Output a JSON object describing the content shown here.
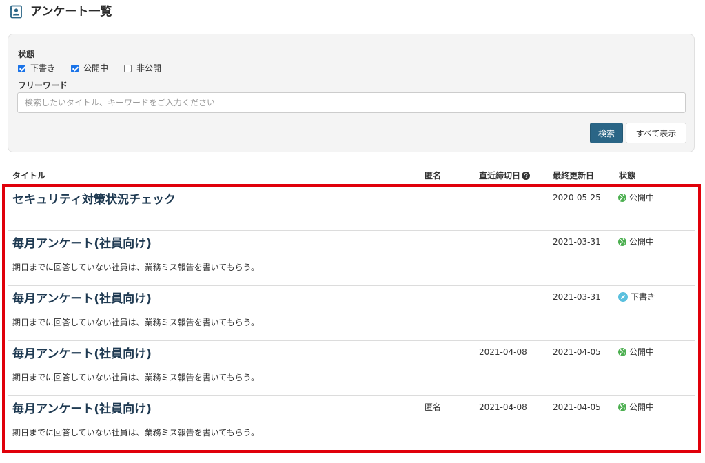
{
  "header": {
    "title": "アンケート一覧"
  },
  "filter": {
    "status_label": "状態",
    "checkboxes": [
      {
        "label": "下書き",
        "checked": true
      },
      {
        "label": "公開中",
        "checked": true
      },
      {
        "label": "非公開",
        "checked": false
      }
    ],
    "keyword_label": "フリーワード",
    "keyword_value": "",
    "keyword_placeholder": "検索したいタイトル、キーワードをご入力ください",
    "search_button": "検索",
    "show_all_button": "すべて表示"
  },
  "table": {
    "headers": {
      "title": "タイトル",
      "anonymous": "匿名",
      "deadline": "直近締切日",
      "updated": "最終更新日",
      "status": "状態"
    },
    "rows": [
      {
        "title": "セキュリティ対策状況チェック",
        "description": "",
        "anonymous": "",
        "deadline": "",
        "updated": "2020-05-25",
        "status": "公開中",
        "status_icon": "globe-icon"
      },
      {
        "title": "毎月アンケート(社員向け)",
        "description": "期日までに回答していない社員は、業務ミス報告を書いてもらう。",
        "anonymous": "",
        "deadline": "",
        "updated": "2021-03-31",
        "status": "公開中",
        "status_icon": "globe-icon"
      },
      {
        "title": "毎月アンケート(社員向け)",
        "description": "期日までに回答していない社員は、業務ミス報告を書いてもらう。",
        "anonymous": "",
        "deadline": "",
        "updated": "2021-03-31",
        "status": "下書き",
        "status_icon": "pencil-icon"
      },
      {
        "title": "毎月アンケート(社員向け)",
        "description": "期日までに回答していない社員は、業務ミス報告を書いてもらう。",
        "anonymous": "",
        "deadline": "2021-04-08",
        "updated": "2021-04-05",
        "status": "公開中",
        "status_icon": "globe-icon"
      },
      {
        "title": "毎月アンケート(社員向け)",
        "description": "期日までに回答していない社員は、業務ミス報告を書いてもらう。",
        "anonymous": "匿名",
        "deadline": "2021-04-08",
        "updated": "2021-04-05",
        "status": "公開中",
        "status_icon": "globe-icon"
      }
    ]
  },
  "colors": {
    "accent": "#2a6586",
    "highlight_border": "#e0000a",
    "published": "#4caf50",
    "draft": "#5bc0de",
    "title_text": "#1f3a52"
  }
}
